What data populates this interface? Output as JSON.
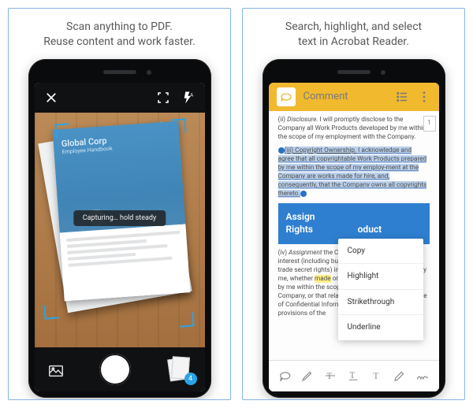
{
  "left": {
    "caption_line1": "Scan anything to PDF.",
    "caption_line2": "Reuse content and work faster.",
    "doc_title": "Global Corp",
    "doc_subtitle": "Employee Handbook",
    "toast": "Capturing… hold steady",
    "thumb_count": "4"
  },
  "right": {
    "caption_line1": "Search, highlight, and select",
    "caption_line2": "text in Acrobat Reader.",
    "toolbar_title": "Comment",
    "page_number": "1",
    "para1_prefix": "(ii) ",
    "para1_em": "Disclosure.",
    "para1_rest": " I will promptly disclose to the Company all Work Products developed by me within the scope of my employment with the Company.",
    "sel_prefix": "(iii) Copyright Ownership.",
    "sel_rest": " I acknowledge and agree that all copyrightable Work Products prepared by me within the scope of my employ-ment at the Company are works made for hire, and, consequently, that the Company owns all copyrights thereto.",
    "heading_line1": "Assign",
    "heading_line2": "Rights",
    "heading_line3": "oduct",
    "para3_prefix": "(iv) ",
    "para3_em": "Assignment",
    "para3_rest1": " the Company all of my other rights, interest (including but not limited to copyright and trade secret rights) in all Work Products prepared by me, whether ",
    "para3_hl": "made",
    "para3_rest2": " or conceived in whole or in part by me within the scope of my employment by the Company, or that relate directly to, or involve the use of Confidential Information. Pursuant to the provisions of the",
    "menu": {
      "copy": "Copy",
      "highlight": "Highlight",
      "strike": "Strikethrough",
      "underline": "Underline"
    }
  }
}
